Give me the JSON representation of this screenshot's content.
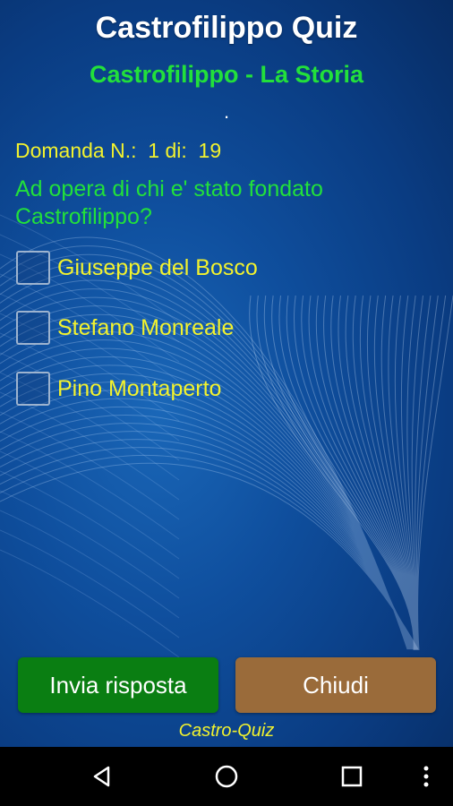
{
  "header": {
    "title": "Castrofilippo Quiz",
    "subtitle": "Castrofilippo - La Storia",
    "separator": "."
  },
  "question": {
    "number_label": "Domanda N.:  1 di:  19",
    "text": "Ad opera di chi e' stato fondato Castrofilippo?"
  },
  "options": [
    {
      "label": "Giuseppe del Bosco",
      "checked": false
    },
    {
      "label": "Stefano Monreale",
      "checked": false
    },
    {
      "label": "Pino Montaperto",
      "checked": false
    }
  ],
  "buttons": {
    "send_label": "Invia risposta",
    "close_label": "Chiudi"
  },
  "footer": {
    "brand": "Castro-Quiz"
  },
  "navbar": {
    "icons": [
      "back-icon",
      "home-icon",
      "recents-icon",
      "more-icon"
    ]
  },
  "colors": {
    "background": "#0b3d86",
    "title": "#ffffff",
    "green_text": "#22e03b",
    "yellow_text": "#f2f22e",
    "send_button": "#0a7e12",
    "close_button": "#9a6b3a",
    "navbar": "#000000"
  }
}
